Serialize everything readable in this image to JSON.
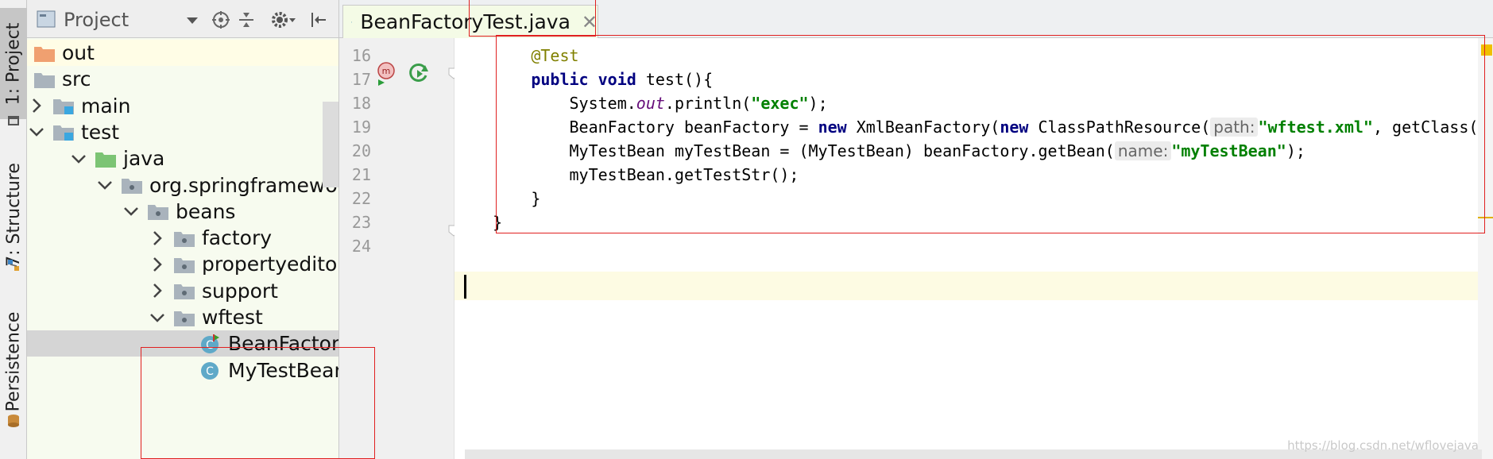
{
  "left_strip": {
    "tabs": [
      {
        "label": "1: Project"
      },
      {
        "label": "7: Structure"
      },
      {
        "label": "Persistence"
      }
    ]
  },
  "project_panel": {
    "title": "Project",
    "tree": [
      {
        "label": "out",
        "type": "folder-orange",
        "expand": "none",
        "selected": false
      },
      {
        "label": "src",
        "type": "folder-gray",
        "expand": "none",
        "selected": false
      },
      {
        "label": "main",
        "type": "folder-source",
        "expand": "collapsed",
        "selected": false
      },
      {
        "label": "test",
        "type": "folder-source",
        "expand": "expanded",
        "selected": false
      },
      {
        "label": "java",
        "type": "folder-green",
        "expand": "expanded",
        "selected": false
      },
      {
        "label": "org.springframework",
        "type": "package",
        "expand": "expanded",
        "selected": false
      },
      {
        "label": "beans",
        "type": "package",
        "expand": "expanded",
        "selected": false
      },
      {
        "label": "factory",
        "type": "package",
        "expand": "collapsed",
        "selected": false
      },
      {
        "label": "propertyeditor",
        "type": "package",
        "expand": "collapsed",
        "selected": false
      },
      {
        "label": "support",
        "type": "package",
        "expand": "collapsed",
        "selected": false
      },
      {
        "label": "wftest",
        "type": "package",
        "expand": "expanded",
        "selected": false
      },
      {
        "label": "BeanFactoryTest",
        "type": "class-test",
        "expand": "none",
        "selected": true
      },
      {
        "label": "MyTestBean",
        "type": "class",
        "expand": "none",
        "selected": false
      }
    ]
  },
  "editor": {
    "tab_label": "BeanFactoryTest.java",
    "close_glyph": "✕",
    "gutter_markers": {
      "line17": [
        "method-marker-icon",
        "run-test-icon"
      ]
    },
    "lines": [
      {
        "num": "16",
        "segments": [
          {
            "t": "        "
          },
          {
            "t": "@Test",
            "c": "ann"
          }
        ]
      },
      {
        "num": "17",
        "segments": [
          {
            "t": "        "
          },
          {
            "t": "public",
            "c": "kw"
          },
          {
            "t": " "
          },
          {
            "t": "void",
            "c": "kw"
          },
          {
            "t": " test(){"
          }
        ]
      },
      {
        "num": "18",
        "segments": [
          {
            "t": "            System."
          },
          {
            "t": "out",
            "c": "fld"
          },
          {
            "t": ".println("
          },
          {
            "t": "\"exec\"",
            "c": "str"
          },
          {
            "t": ");"
          }
        ]
      },
      {
        "num": "19",
        "segments": [
          {
            "t": "            BeanFactory beanFactory = "
          },
          {
            "t": "new",
            "c": "kw"
          },
          {
            "t": " XmlBeanFactory("
          },
          {
            "t": "new",
            "c": "kw"
          },
          {
            "t": " ClassPathResource("
          },
          {
            "t": "path:",
            "c": "hint"
          },
          {
            "t": "\"wftest.xml\"",
            "c": "str"
          },
          {
            "t": ", getClass()));"
          }
        ]
      },
      {
        "num": "20",
        "segments": [
          {
            "t": "            MyTestBean myTestBean = (MyTestBean) beanFactory.getBean("
          },
          {
            "t": "name:",
            "c": "hint"
          },
          {
            "t": "\"myTestBean\"",
            "c": "str"
          },
          {
            "t": ");"
          }
        ]
      },
      {
        "num": "21",
        "segments": [
          {
            "t": "            myTestBean.getTestStr();"
          }
        ]
      },
      {
        "num": "22",
        "segments": [
          {
            "t": "        }"
          }
        ]
      },
      {
        "num": "23",
        "segments": [
          {
            "t": "    }"
          }
        ]
      },
      {
        "num": "24",
        "segments": [
          {
            "t": ""
          }
        ]
      }
    ]
  },
  "watermark": "https://blog.csdn.net/wflovejava",
  "colors": {
    "current_line": "#fdfbe3",
    "highlight_red": "#e02020",
    "tab_active": "#f4fbe6",
    "out_row": "#fffde6"
  }
}
